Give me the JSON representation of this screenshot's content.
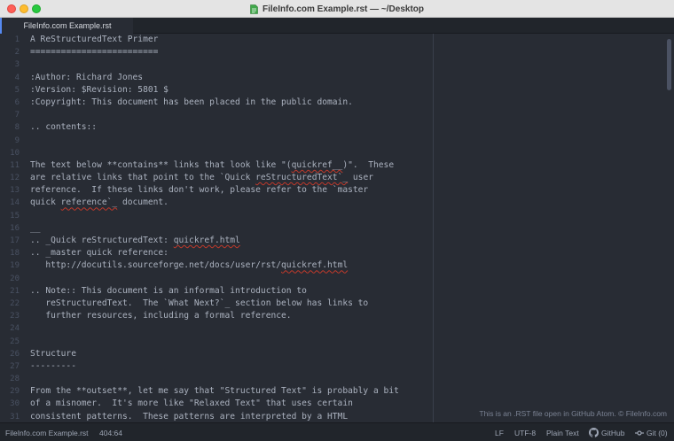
{
  "window": {
    "title": "FileInfo.com Example.rst — ~/Desktop"
  },
  "tabs": [
    {
      "label": "FileInfo.com Example.rst"
    }
  ],
  "editor": {
    "lines": [
      "A ReStructuredText Primer",
      "=========================",
      "",
      ":Author: Richard Jones",
      ":Version: $Revision: 5801 $",
      ":Copyright: This document has been placed in the public domain.",
      "",
      ".. contents::",
      "",
      "",
      "The text below **contains** links that look like \"(quickref__)\".  These",
      "are relative links that point to the `Quick reStructuredText`_ user",
      "reference.  If these links don't work, please refer to the `master",
      "quick reference`_ document.",
      "",
      "__",
      ".. _Quick reStructuredText: quickref.html",
      ".. _master quick reference:",
      "   http://docutils.sourceforge.net/docs/user/rst/quickref.html",
      "",
      ".. Note:: This document is an informal introduction to",
      "   reStructuredText.  The `What Next?`_ section below has links to",
      "   further resources, including a formal reference.",
      "",
      "",
      "Structure",
      "---------",
      "",
      "From the **outset**, let me say that \"Structured Text\" is probably a bit",
      "of a misnomer.  It's more like \"Relaxed Text\" that uses certain",
      "consistent patterns.  These patterns are interpreted by a HTML"
    ],
    "watermark": "This is an .RST file open in GitHub Atom. © FileInfo.com"
  },
  "status_bar": {
    "file_name": "FileInfo.com Example.rst",
    "cursor": "404:64",
    "line_ending": "LF",
    "encoding": "UTF-8",
    "grammar": "Plain Text",
    "github": "GitHub",
    "git": "Git (0)"
  }
}
